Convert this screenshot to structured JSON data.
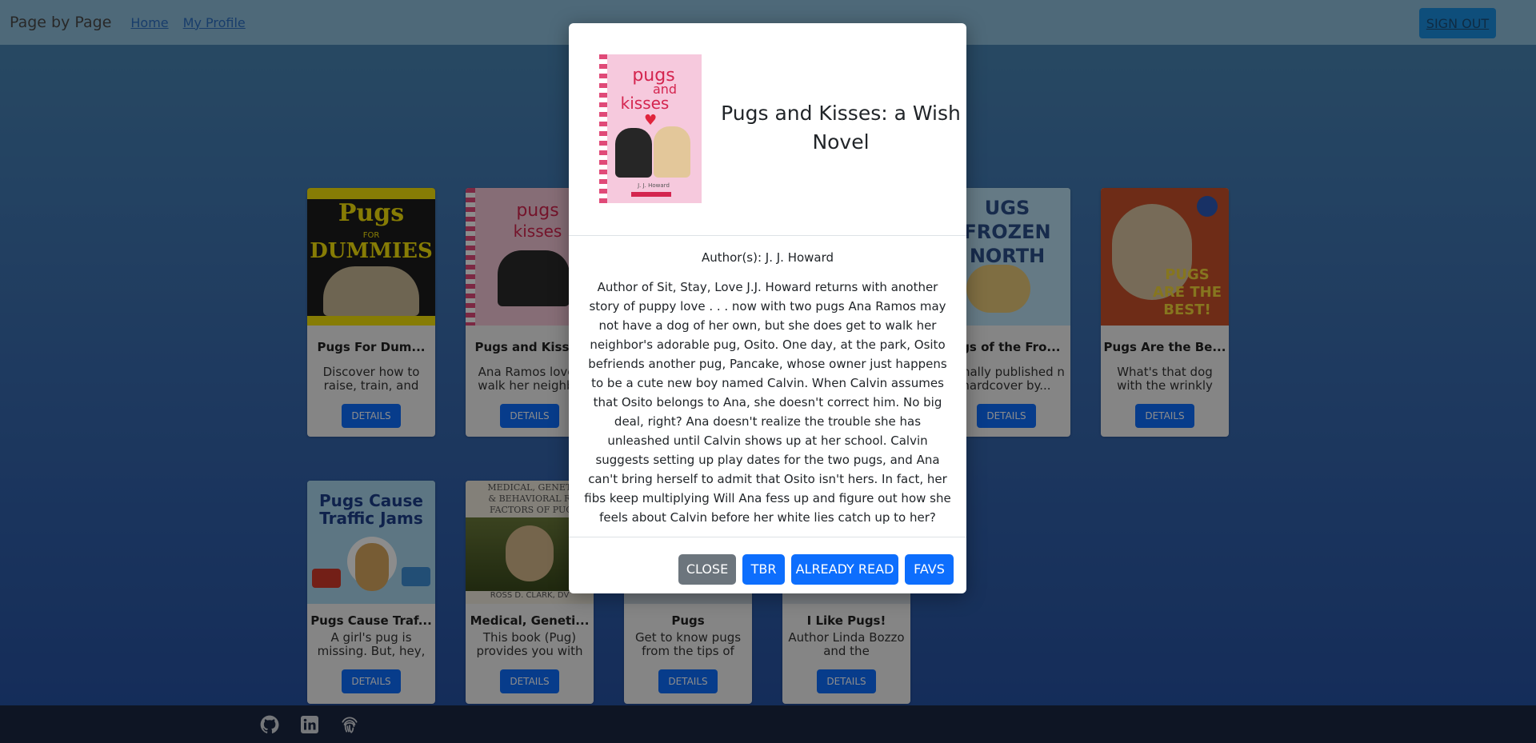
{
  "nav": {
    "brand": "Page by Page",
    "links": [
      "Home",
      "My Profile"
    ],
    "sign_out": "SIGN OUT"
  },
  "books": [
    {
      "title": "Pugs For Dum...",
      "desc": "Discover how to raise, train, and enjo...",
      "button": "DETAILS"
    },
    {
      "title": "Pugs and Kisses",
      "desc": "Ana Ramos loves walk her neighbo",
      "button": "DETAILS"
    },
    {
      "title": "",
      "desc": "",
      "button": ""
    },
    {
      "title": "ugs of the Fro...",
      "desc": "iginally published n hardcover by...",
      "button": "DETAILS"
    },
    {
      "title": "Pugs Are the Be...",
      "desc": "What's that dog with the wrinkly muzzle,...",
      "button": "DETAILS"
    },
    {
      "title": "Pugs Cause Traf...",
      "desc": "A girl's pug is missing. But, hey, h...",
      "button": "DETAILS"
    },
    {
      "title": "Medical, Geneti...",
      "desc": "This book (Pug) provides you with a...",
      "button": "DETAILS"
    },
    {
      "title": "Pugs",
      "desc": "Get to know pugs from the tips of thei...",
      "button": "DETAILS"
    },
    {
      "title": "I Like Pugs!",
      "desc": "Author Linda Bozzo and the American...",
      "button": "DETAILS"
    }
  ],
  "covers": {
    "dummies": {
      "top": "Pugs",
      "mid": "FOR",
      "bottom": "DUMMIES"
    },
    "kisses": {
      "line1": "pugs",
      "line2": "and",
      "line3": "kisses",
      "author": "J. J. Howard"
    },
    "frozen": {
      "text": "UGS FROZEN NORTH"
    },
    "best": {
      "text": "PUGS ARE THE BEST!"
    },
    "traffic": {
      "line1": "Pugs Cause",
      "line2": "Traffic Jams"
    },
    "medical": {
      "line1": "MEDICAL, GENETI",
      "line2": "& BEHAVIORAL RI",
      "line3": "FACTORS OF PUG",
      "author": "ROSS D. CLARK, DV"
    }
  },
  "modal": {
    "title": "Pugs and Kisses: a Wish Novel",
    "author": "Author(s): J. J. Howard",
    "description": "Author of Sit, Stay, Love J.J. Howard returns with another story of puppy love . . . now with two pugs Ana Ramos may not have a dog of her own, but she does get to walk her neighbor's adorable pug, Osito. One day, at the park, Osito befriends another pug, Pancake, whose owner just happens to be a cute new boy named Calvin. When Calvin assumes that Osito belongs to Ana, she doesn't correct him. No big deal, right? Ana doesn't realize the trouble she has unleashed until Calvin shows up at her school. Calvin suggests setting up play dates for the two pugs, and Ana can't bring herself to admit that Osito isn't hers. In fact, her fibs keep multiplying Will Ana fess up and figure out how she feels about Calvin before her white lies catch up to her?",
    "buttons": {
      "close": "CLOSE",
      "tbr": "TBR",
      "read": "ALREADY READ",
      "favs": "FAVS"
    }
  },
  "colors": {
    "primary": "#0d6efd",
    "secondary": "#6c757d"
  },
  "footer": {
    "icons": [
      "github-icon",
      "linkedin-icon",
      "fingerprint-icon"
    ]
  }
}
